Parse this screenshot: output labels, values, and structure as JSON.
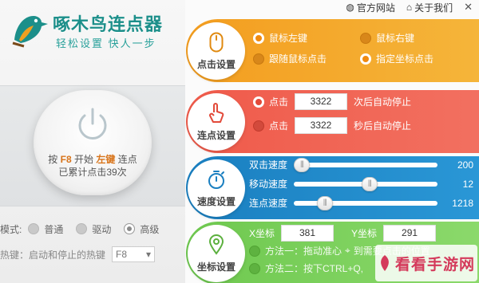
{
  "app": {
    "title": "啄木鸟连点器",
    "subtitle": "轻松设置  快人一步"
  },
  "topbar": {
    "official_site": "官方网站",
    "about": "关于我们",
    "close": "✕"
  },
  "hero": {
    "press": "按",
    "hotkey": "F8",
    "start": "开始",
    "button_name": "左键",
    "click_word": "连点",
    "count_text": "已累计点击39次"
  },
  "mode": {
    "label": "模式:",
    "options": [
      "普通",
      "驱动",
      "高级"
    ],
    "selected": "高级"
  },
  "hotkey_row": {
    "label": "热键：启动和停止的热键",
    "value": "F8"
  },
  "click_settings": {
    "label": "点击设置",
    "options": [
      "鼠标左键",
      "鼠标右键",
      "跟随鼠标点击",
      "指定坐标点击"
    ],
    "selected": [
      "鼠标左键",
      "指定坐标点击"
    ]
  },
  "repeat_settings": {
    "label": "连点设置",
    "rows": [
      {
        "prefix": "点击",
        "value": "3322",
        "suffix": "次后自动停止"
      },
      {
        "prefix": "点击",
        "value": "3322",
        "suffix": "秒后自动停止"
      }
    ]
  },
  "speed_settings": {
    "label": "速度设置",
    "sliders": [
      {
        "label": "双击速度",
        "value": "200",
        "fraction": 0.0
      },
      {
        "label": "移动速度",
        "value": "12",
        "fraction": 0.53
      },
      {
        "label": "连点速度",
        "value": "1218",
        "fraction": 0.18
      }
    ]
  },
  "coord_settings": {
    "label": "坐标设置",
    "x_label": "X坐标",
    "x_value": "381",
    "y_label": "Y坐标",
    "y_value": "291",
    "method1": "方法一：拖动准心",
    "method1_tail": "到需要点击的位置",
    "method2": "方法二：按下CTRL+Q,"
  },
  "watermark": {
    "text": "看看手游网"
  },
  "colors": {
    "orange": "#f39d1f",
    "red": "#ef5a4a",
    "blue": "#1a7fc0",
    "green": "#6ec84f",
    "brand": "#1c8f8a"
  }
}
